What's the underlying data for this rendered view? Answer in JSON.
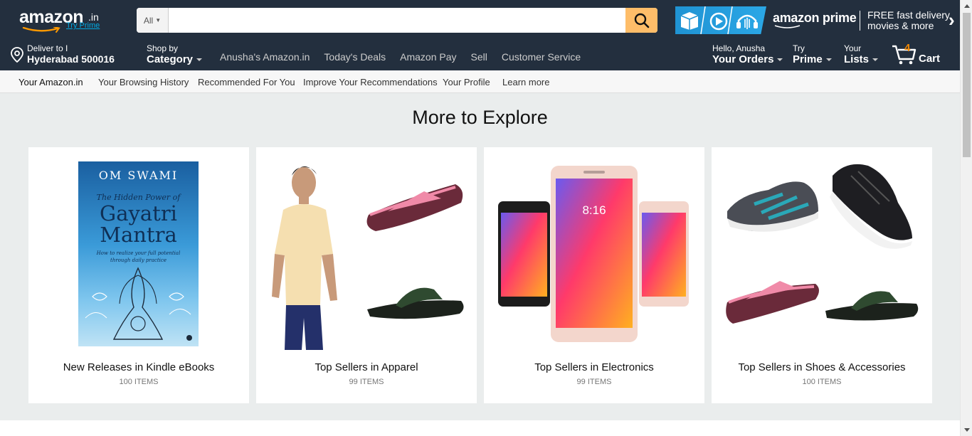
{
  "colors": {
    "nav_bg": "#232f3e",
    "search_button": "#febd69",
    "cart_count": "#f08804",
    "try_prime_link": "#00a8e1",
    "page_bg": "#eaeded"
  },
  "header": {
    "logo_text": "amazon",
    "logo_suffix": ".in",
    "try_prime": "Try Prime",
    "search": {
      "category_label": "All",
      "value": "",
      "placeholder": ""
    },
    "prime": {
      "logo_bold": "amazon",
      "logo_light": "prime",
      "line1": "FREE fast delivery,",
      "line2": "movies & more"
    }
  },
  "nav": {
    "deliver": {
      "line1": "Deliver to I",
      "line2": "Hyderabad 500016"
    },
    "shop_by": {
      "line1": "Shop by",
      "line2": "Category"
    },
    "links": [
      "Anusha's Amazon.in",
      "Today's Deals",
      "Amazon Pay",
      "Sell",
      "Customer Service"
    ],
    "account": {
      "line1": "Hello, Anusha",
      "line2": "Your Orders"
    },
    "prime": {
      "line1": "Try",
      "line2": "Prime"
    },
    "lists": {
      "line1": "Your",
      "line2": "Lists"
    },
    "cart": {
      "count": "4",
      "label": "Cart"
    }
  },
  "subnav": {
    "items": [
      "Your Amazon.in",
      "Your Browsing History",
      "Recommended For You",
      "Improve Your Recommendations",
      "Your Profile",
      "Learn more"
    ]
  },
  "main": {
    "title": "More to Explore",
    "cards": [
      {
        "title": "New Releases in Kindle eBooks",
        "count": "100 ITEMS",
        "book": {
          "author": "OM SWAMI",
          "subtitle": "The Hidden Power of",
          "title1": "Gayatri",
          "title2": "Mantra",
          "tagline": "How to realize your full potential through daily practice"
        }
      },
      {
        "title": "Top Sellers in Apparel",
        "count": "99 ITEMS"
      },
      {
        "title": "Top Sellers in Electronics",
        "count": "99 ITEMS",
        "phone_time": "8:16"
      },
      {
        "title": "Top Sellers in Shoes & Accessories",
        "count": "100 ITEMS"
      }
    ]
  }
}
